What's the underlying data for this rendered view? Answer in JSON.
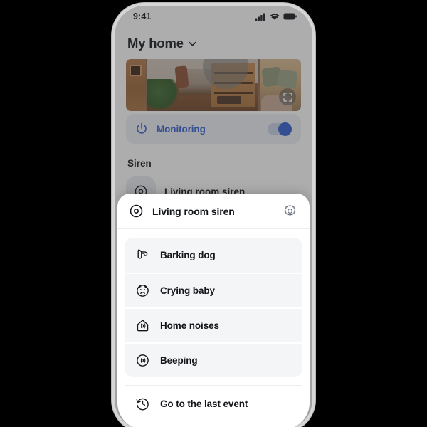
{
  "status_bar": {
    "time": "9:41",
    "icons": [
      "signal-icon",
      "wifi-icon",
      "battery-icon"
    ]
  },
  "header": {
    "title": "My home",
    "chevron": "chevron-down-icon"
  },
  "camera": {
    "expand_icon": "fullscreen-expand-icon"
  },
  "monitoring_card": {
    "icon": "power-icon",
    "label": "Monitoring",
    "toggle_state": "on",
    "accent_color": "#2f5cd0",
    "card_bg": "#eef0f5"
  },
  "siren_section": {
    "title": "Siren",
    "device": {
      "icon": "siren-icon",
      "label": "Living room siren"
    }
  },
  "sheet": {
    "header": {
      "icon": "siren-icon",
      "title": "Living room siren",
      "settings_icon": "gear-icon"
    },
    "sounds": [
      {
        "icon": "dog-icon",
        "label": "Barking dog"
      },
      {
        "icon": "baby-face-icon",
        "label": "Crying baby"
      },
      {
        "icon": "house-sound-icon",
        "label": "Home noises"
      },
      {
        "icon": "beep-sound-icon",
        "label": "Beeping"
      }
    ],
    "footer": {
      "icon": "history-clock-icon",
      "label": "Go to the last event"
    }
  },
  "colors": {
    "background": "#000000",
    "phone_frame": "#d6d6d6",
    "sheet_bg": "#ffffff",
    "list_bg": "#f4f5f7",
    "text": "#14161a",
    "accent": "#2f5cd0"
  }
}
